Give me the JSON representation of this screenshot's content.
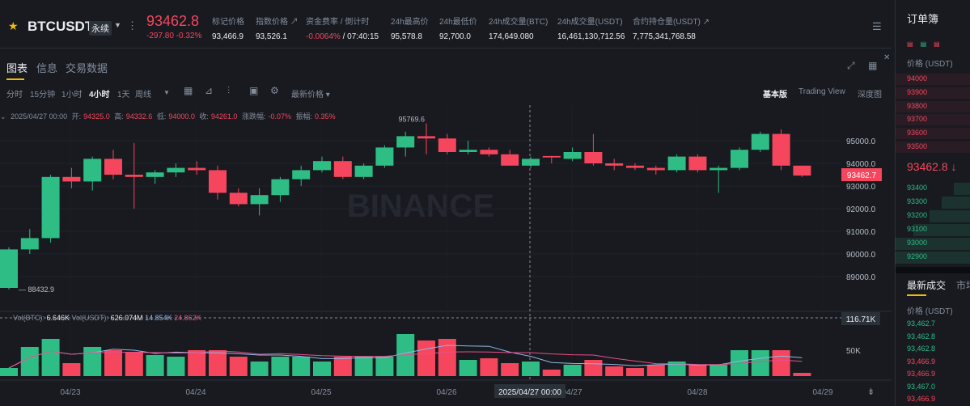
{
  "header": {
    "symbol": "BTCUSDT",
    "contract_type": "永续",
    "last_price": "93462.8",
    "change": "-297.80 -0.32%",
    "stats": [
      {
        "label": "标记价格",
        "value": "93,466.9"
      },
      {
        "label": "指数价格 ↗",
        "value": "93,526.1"
      },
      {
        "label": "资金费率 / 倒计时",
        "value": "-0.0064% / 07:40:15"
      },
      {
        "label": "24h最高价",
        "value": "95,578.8"
      },
      {
        "label": "24h最低价",
        "value": "92,700.0"
      },
      {
        "label": "24h成交量(BTC)",
        "value": "174,649.080"
      },
      {
        "label": "24h成交量(USDT)",
        "value": "16,461,130,712.56"
      },
      {
        "label": "合约持仓量(USDT) ↗",
        "value": "7,775,341,768.58"
      }
    ]
  },
  "tabs": [
    "图表",
    "信息",
    "交易数据"
  ],
  "toolbar": {
    "intervals": [
      "分时",
      "15分钟",
      "1小时",
      "4小时",
      "1天",
      "周线"
    ],
    "active_interval": "4小时",
    "price_type": "最新价格",
    "views": [
      "基本版",
      "Trading View",
      "深度图"
    ],
    "active_view": "基本版"
  },
  "ohlc": {
    "date": "2025/04/27 00:00",
    "open_label": "开:",
    "open": "94325.0",
    "high_label": "高:",
    "high": "94332.6",
    "low_label": "低:",
    "low": "94000.0",
    "close_label": "收:",
    "close": "94261.0",
    "change_label": "涨跌幅:",
    "change": "-0.07%",
    "amp_label": "振幅:",
    "amp": "0.35%"
  },
  "chart_data": {
    "type": "candlestick",
    "watermark": "BINANCE",
    "y_ticks": [
      89000,
      90000,
      91000,
      92000,
      93000,
      94000,
      95000
    ],
    "y_tick_labels": [
      "89000.0",
      "90000.0",
      "91000.0",
      "92000.0",
      "93000.0",
      "94000.0",
      "95000.0"
    ],
    "x_tick_labels": [
      "04/23",
      "04/24",
      "04/25",
      "04/26",
      "04/27",
      "04/28",
      "04/29"
    ],
    "current_price_label": "93462.7",
    "high_marker": "95769.6",
    "low_marker": "88432.9",
    "crosshair_time": "2025/04/27 00:00",
    "crosshair_volume": "116.71K",
    "volume_axis_label": "50K",
    "volume_legend": {
      "vol_btc_label": "Vol(BTC):",
      "vol_btc": "6.646K",
      "vol_usdt_label": "Vol(USDT):",
      "vol_usdt": "626.074M",
      "ma1": "14.854K",
      "ma2": "24.862K"
    },
    "candles": [
      {
        "o": 88500,
        "h": 90300,
        "l": 88433,
        "c": 90200
      },
      {
        "o": 90200,
        "h": 91100,
        "l": 90000,
        "c": 90700
      },
      {
        "o": 90700,
        "h": 93500,
        "l": 90500,
        "c": 93400
      },
      {
        "o": 93400,
        "h": 93800,
        "l": 92900,
        "c": 93200
      },
      {
        "o": 93200,
        "h": 94300,
        "l": 92800,
        "c": 94200
      },
      {
        "o": 94200,
        "h": 94600,
        "l": 93300,
        "c": 93500
      },
      {
        "o": 93500,
        "h": 94900,
        "l": 92000,
        "c": 93400
      },
      {
        "o": 93400,
        "h": 93700,
        "l": 93100,
        "c": 93600
      },
      {
        "o": 93600,
        "h": 94000,
        "l": 93400,
        "c": 93800
      },
      {
        "o": 93800,
        "h": 94100,
        "l": 93500,
        "c": 93700
      },
      {
        "o": 93700,
        "h": 93900,
        "l": 92400,
        "c": 92700
      },
      {
        "o": 92700,
        "h": 92900,
        "l": 92100,
        "c": 92200
      },
      {
        "o": 92200,
        "h": 92900,
        "l": 91700,
        "c": 92600
      },
      {
        "o": 92600,
        "h": 93400,
        "l": 92300,
        "c": 93300
      },
      {
        "o": 93300,
        "h": 93900,
        "l": 93000,
        "c": 93700
      },
      {
        "o": 93700,
        "h": 94300,
        "l": 93600,
        "c": 94100
      },
      {
        "o": 94100,
        "h": 94300,
        "l": 93300,
        "c": 93400
      },
      {
        "o": 93400,
        "h": 94000,
        "l": 93300,
        "c": 93900
      },
      {
        "o": 93900,
        "h": 94800,
        "l": 93800,
        "c": 94700
      },
      {
        "o": 94700,
        "h": 95400,
        "l": 94300,
        "c": 95200
      },
      {
        "o": 95200,
        "h": 95770,
        "l": 94400,
        "c": 95100
      },
      {
        "o": 95100,
        "h": 95300,
        "l": 94400,
        "c": 94500
      },
      {
        "o": 94500,
        "h": 95000,
        "l": 94400,
        "c": 94600
      },
      {
        "o": 94600,
        "h": 94700,
        "l": 94300,
        "c": 94400
      },
      {
        "o": 94400,
        "h": 94600,
        "l": 93900,
        "c": 93900
      },
      {
        "o": 93900,
        "h": 94300,
        "l": 93800,
        "c": 94200
      },
      {
        "o": 94325,
        "h": 94333,
        "l": 94000,
        "c": 94261
      },
      {
        "o": 94200,
        "h": 94700,
        "l": 94100,
        "c": 94500
      },
      {
        "o": 94500,
        "h": 95300,
        "l": 93900,
        "c": 94000
      },
      {
        "o": 94000,
        "h": 94200,
        "l": 93700,
        "c": 93900
      },
      {
        "o": 93900,
        "h": 94000,
        "l": 93700,
        "c": 93800
      },
      {
        "o": 93800,
        "h": 93900,
        "l": 93500,
        "c": 93700
      },
      {
        "o": 93700,
        "h": 94400,
        "l": 93600,
        "c": 94300
      },
      {
        "o": 94300,
        "h": 94400,
        "l": 93600,
        "c": 93700
      },
      {
        "o": 93700,
        "h": 93900,
        "l": 92700,
        "c": 93800
      },
      {
        "o": 93800,
        "h": 94700,
        "l": 93700,
        "c": 94600
      },
      {
        "o": 94600,
        "h": 95400,
        "l": 94500,
        "c": 95300
      },
      {
        "o": 95300,
        "h": 95500,
        "l": 93700,
        "c": 93900
      },
      {
        "o": 93900,
        "h": 93900,
        "l": 93400,
        "c": 93462
      }
    ],
    "volumes": [
      10,
      36,
      46,
      16,
      36,
      32,
      30,
      26,
      24,
      32,
      32,
      24,
      18,
      24,
      24,
      18,
      24,
      24,
      24,
      52,
      44,
      46,
      20,
      22,
      16,
      18,
      8,
      14,
      20,
      12,
      10,
      14,
      18,
      14,
      14,
      32,
      32,
      32,
      4
    ]
  },
  "orderbook": {
    "title": "订单簿",
    "price_label": "价格 (USDT)",
    "asks": [
      "94000",
      "93900",
      "93800",
      "93700",
      "93600",
      "93500"
    ],
    "mid_price": "93462.8 ↓",
    "bids": [
      "93400",
      "93300",
      "93200",
      "93100",
      "93000",
      "92900"
    ]
  },
  "trades": {
    "title": "最新成交",
    "title2": "市场",
    "price_label": "价格 (USDT)",
    "rows": [
      {
        "price": "93,462.7",
        "color": "#2ebd85"
      },
      {
        "price": "93,462.8",
        "color": "#2ebd85"
      },
      {
        "price": "93,462.8",
        "color": "#2ebd85"
      },
      {
        "price": "93,466.9",
        "color": "#f6465d"
      },
      {
        "price": "93,466.9",
        "color": "#f6465d"
      },
      {
        "price": "93,467.0",
        "color": "#2ebd85"
      },
      {
        "price": "93,466.9",
        "color": "#f6465d"
      }
    ]
  },
  "colors": {
    "up": "#2ebd85",
    "down": "#f6465d",
    "accent": "#f0b90b",
    "bg": "#181a20"
  }
}
